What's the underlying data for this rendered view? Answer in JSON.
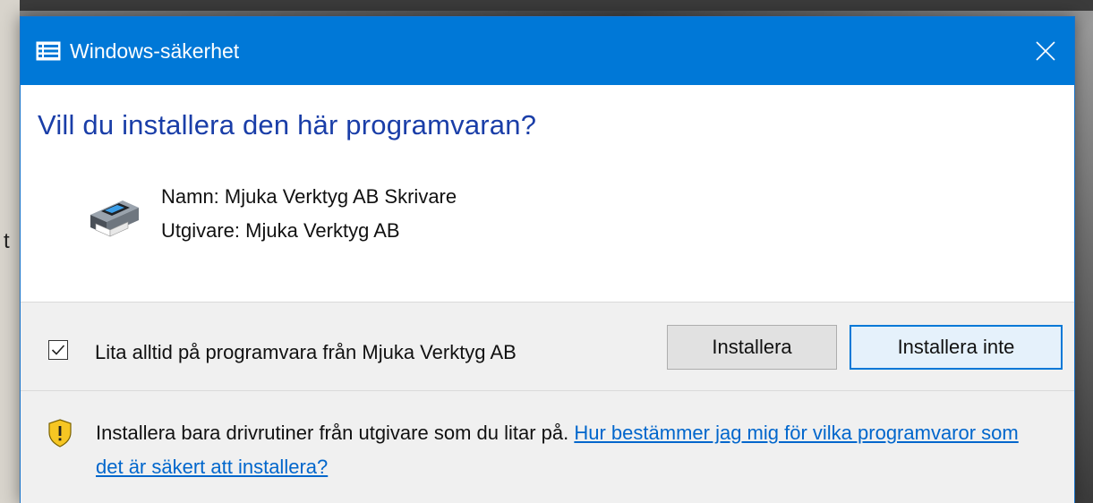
{
  "window": {
    "title": "Windows-säkerhet",
    "title_icon": "list-window-icon",
    "close_icon": "close-icon",
    "accent_color": "#0078d7"
  },
  "prompt": {
    "question": "Vill du installera den här programvaran?",
    "name_line": "Namn: Mjuka Verktyg AB Skrivare",
    "publisher_line": "Utgivare: Mjuka Verktyg AB",
    "device_icon": "printer-icon",
    "question_color": "#1a3ea8"
  },
  "actions": {
    "always_trust_label": "Lita alltid på programvara från Mjuka Verktyg AB",
    "always_trust_checked": true,
    "install_label": "Installera",
    "dont_install_label": "Installera inte"
  },
  "footer": {
    "warning_icon": "shield-warning-icon",
    "text": "Installera bara drivrutiner från utgivare som du litar på.",
    "link_text": "Hur bestämmer jag mig för vilka programvaror som det är säkert att installera?",
    "link_color": "#0066cc"
  },
  "background": {
    "partial_text": "t"
  }
}
